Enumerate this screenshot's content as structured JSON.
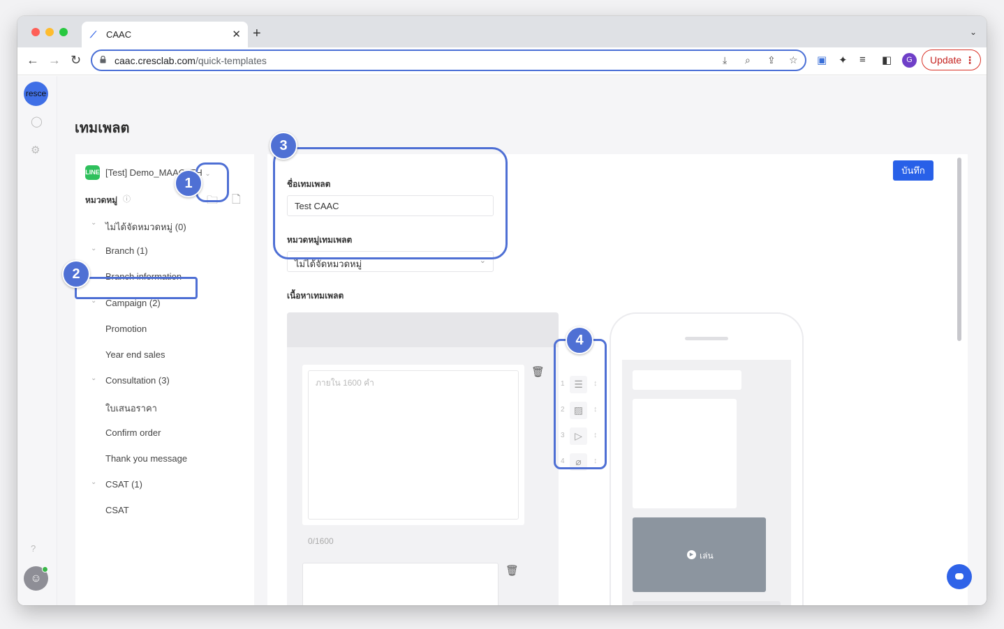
{
  "browser": {
    "tab_title": "CAAC",
    "url_host": "caac.cresclab.com",
    "url_path": "/quick-templates",
    "update_label": "Update",
    "profile_initial": "G"
  },
  "rail": {
    "logo_text": "resce"
  },
  "page": {
    "title": "เทมเพลต"
  },
  "left_panel": {
    "bot_icon_text": "LINE",
    "bot_name": "[Test] Demo_MAAC_TH",
    "category_label": "หมวดหมู่",
    "tree": [
      {
        "label": "ไม่ได้จัดหมวดหมู่ (0)",
        "level": 0
      },
      {
        "label": "Branch  (1)",
        "level": 0
      },
      {
        "label": "Branch information",
        "level": 1
      },
      {
        "label": "Campaign  (2)",
        "level": 0
      },
      {
        "label": "Promotion",
        "level": 1
      },
      {
        "label": "Year end sales",
        "level": 1
      },
      {
        "label": "Consultation  (3)",
        "level": 0
      },
      {
        "label": "ใบเสนอราคา",
        "level": 1
      },
      {
        "label": "Confirm order",
        "level": 1
      },
      {
        "label": "Thank you message",
        "level": 1
      },
      {
        "label": "CSAT  (1)",
        "level": 0
      },
      {
        "label": "CSAT",
        "level": 1
      }
    ]
  },
  "form": {
    "name_label": "ชื่อเทมเพลต",
    "name_value": "Test CAAC",
    "category_label": "หมวดหมู่เทมเพลต",
    "category_value": "ไม่ได้จัดหมวดหมู่",
    "content_label": "เนื้อหาเทมเพลต",
    "save_label": "บันทึก"
  },
  "editor": {
    "placeholder": "ภายใน 1600 คำ",
    "char_count": "0/1600"
  },
  "add_bar": [
    {
      "num": "1",
      "icon": "text-icon"
    },
    {
      "num": "2",
      "icon": "image-icon"
    },
    {
      "num": "3",
      "icon": "video-icon"
    },
    {
      "num": "4",
      "icon": "attachment-icon"
    }
  ],
  "preview": {
    "play_label": "เล่น"
  },
  "callouts": [
    "1",
    "2",
    "3",
    "4"
  ],
  "colors": {
    "accent": "#2860e8",
    "callout": "#4f70d4",
    "line_green": "#2ec05c"
  }
}
